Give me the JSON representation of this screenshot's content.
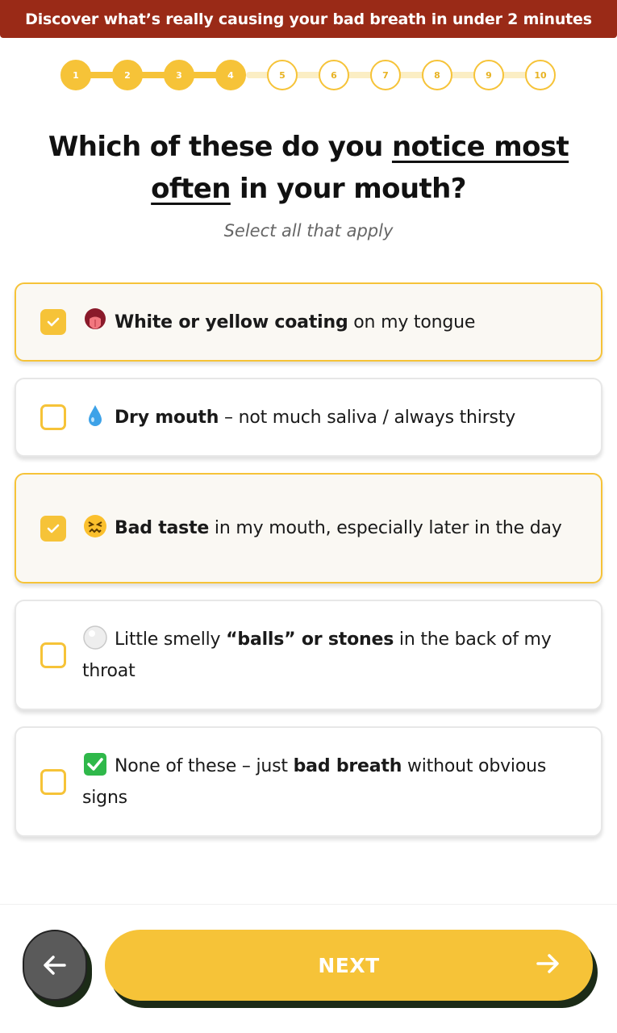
{
  "banner": {
    "text": "Discover what’s really causing your bad breath in under 2 minutes"
  },
  "progress": {
    "current_step": 4,
    "steps": [
      "1",
      "2",
      "3",
      "4",
      "5",
      "6",
      "7",
      "8",
      "9",
      "10"
    ]
  },
  "question": {
    "part1": "Which of these do you ",
    "emphasis": "notice most often",
    "part2": " in your mouth?"
  },
  "subtitle": "Select all that apply",
  "options": [
    {
      "selected": true,
      "emoji": "tongue-emoji",
      "bold": "White or yellow coating",
      "rest": " on my tongue",
      "prefix": ""
    },
    {
      "selected": false,
      "emoji": "droplet-emoji",
      "bold": "Dry mouth",
      "rest": " – not much saliva / always thirsty",
      "prefix": ""
    },
    {
      "selected": true,
      "emoji": "confounded-face-emoji",
      "bold": "Bad taste",
      "rest": " in my mouth, especially later in the day",
      "prefix": ""
    },
    {
      "selected": false,
      "emoji": "white-circle-emoji",
      "prefix": "Little smelly ",
      "bold": "“balls” or stones",
      "rest": " in the back of my throat"
    },
    {
      "selected": false,
      "emoji": "check-mark-emoji",
      "prefix": "None of these – just ",
      "bold": "bad breath",
      "rest": " without obvious signs"
    }
  ],
  "nav": {
    "next_label": "NEXT",
    "back_icon": "arrow-left-icon",
    "next_icon": "arrow-right-icon"
  },
  "colors": {
    "banner": "#9a2a17",
    "accent": "#f6c338",
    "shadow": "#1c2b17"
  }
}
